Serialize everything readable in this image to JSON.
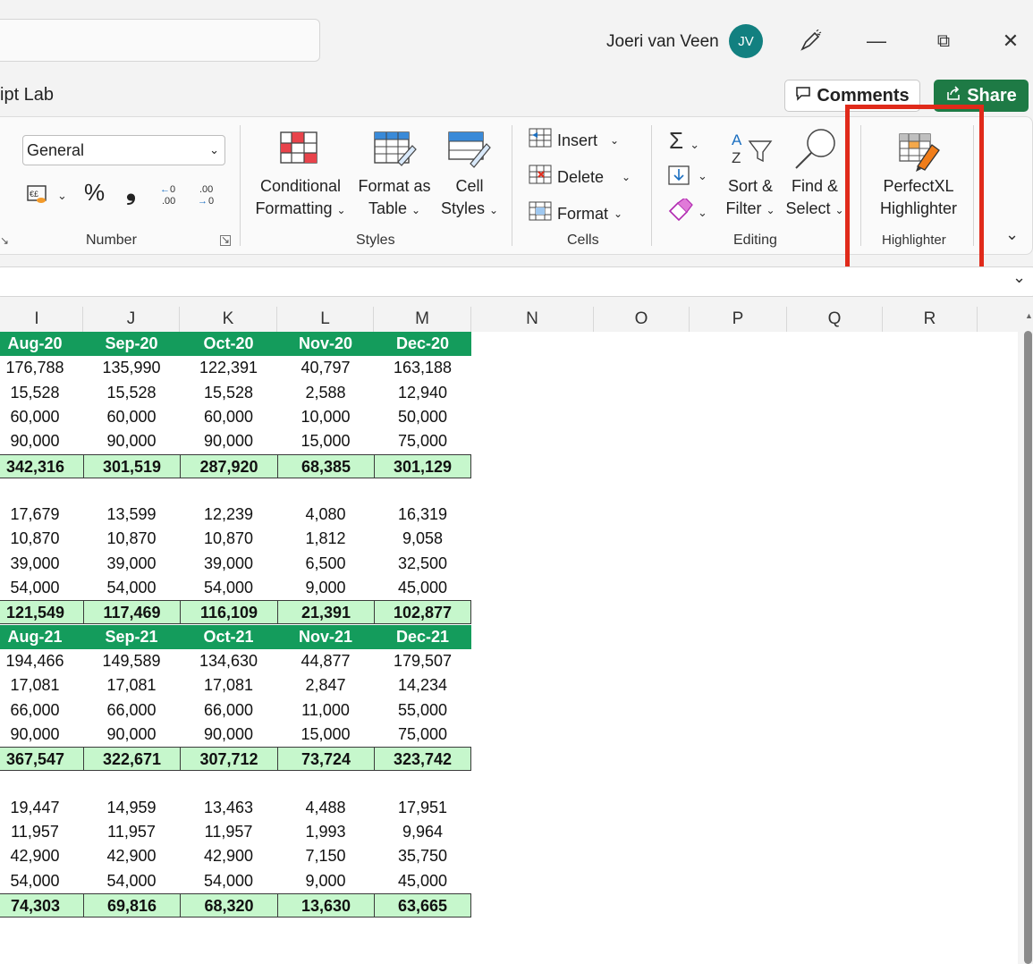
{
  "titlebar": {
    "user_name": "Joeri van Veen",
    "avatar_initials": "JV",
    "minimize": "—",
    "restore": "⧉",
    "close": "✕"
  },
  "tabbar": {
    "tab_partial": "ipt Lab",
    "comments_label": "Comments",
    "share_label": "Share"
  },
  "ribbon": {
    "number": {
      "format_value": "General",
      "percent": "%",
      "comma": "❟",
      "inc_decimal": "←0 .00",
      "dec_decimal": ".00 →0",
      "group_label": "Number"
    },
    "styles": {
      "conditional_line1": "Conditional",
      "conditional_line2": "Formatting",
      "format_table_line1": "Format as",
      "format_table_line2": "Table",
      "cell_styles_line1": "Cell",
      "cell_styles_line2": "Styles",
      "group_label": "Styles"
    },
    "cells": {
      "insert": "Insert",
      "delete": "Delete",
      "format": "Format",
      "group_label": "Cells"
    },
    "editing": {
      "sort_line1": "Sort &",
      "sort_line2": "Filter",
      "find_line1": "Find &",
      "find_line2": "Select",
      "group_label": "Editing"
    },
    "highlighter": {
      "line1": "PerfectXL",
      "line2": "Highlighter",
      "group_label": "Highlighter"
    }
  },
  "grid": {
    "columns": [
      "I",
      "J",
      "K",
      "L",
      "M",
      "N",
      "O",
      "P",
      "Q",
      "R"
    ],
    "blocks": [
      {
        "header": [
          "Aug-20",
          "Sep-20",
          "Oct-20",
          "Nov-20",
          "Dec-20"
        ],
        "rows": [
          [
            "176,788",
            "135,990",
            "122,391",
            "40,797",
            "163,188"
          ],
          [
            "15,528",
            "15,528",
            "15,528",
            "2,588",
            "12,940"
          ],
          [
            "60,000",
            "60,000",
            "60,000",
            "10,000",
            "50,000"
          ],
          [
            "90,000",
            "90,000",
            "90,000",
            "15,000",
            "75,000"
          ]
        ],
        "total": [
          "342,316",
          "301,519",
          "287,920",
          "68,385",
          "301,129"
        ]
      },
      {
        "header": null,
        "rows": [
          [
            "17,679",
            "13,599",
            "12,239",
            "4,080",
            "16,319"
          ],
          [
            "10,870",
            "10,870",
            "10,870",
            "1,812",
            "9,058"
          ],
          [
            "39,000",
            "39,000",
            "39,000",
            "6,500",
            "32,500"
          ],
          [
            "54,000",
            "54,000",
            "54,000",
            "9,000",
            "45,000"
          ]
        ],
        "total": [
          "121,549",
          "117,469",
          "116,109",
          "21,391",
          "102,877"
        ]
      },
      {
        "header": [
          "Aug-21",
          "Sep-21",
          "Oct-21",
          "Nov-21",
          "Dec-21"
        ],
        "rows": [
          [
            "194,466",
            "149,589",
            "134,630",
            "44,877",
            "179,507"
          ],
          [
            "17,081",
            "17,081",
            "17,081",
            "2,847",
            "14,234"
          ],
          [
            "66,000",
            "66,000",
            "66,000",
            "11,000",
            "55,000"
          ],
          [
            "90,000",
            "90,000",
            "90,000",
            "15,000",
            "75,000"
          ]
        ],
        "total": [
          "367,547",
          "322,671",
          "307,712",
          "73,724",
          "323,742"
        ]
      },
      {
        "header": null,
        "rows": [
          [
            "19,447",
            "14,959",
            "13,463",
            "4,488",
            "17,951"
          ],
          [
            "11,957",
            "11,957",
            "11,957",
            "1,993",
            "9,964"
          ],
          [
            "42,900",
            "42,900",
            "42,900",
            "7,150",
            "35,750"
          ],
          [
            "54,000",
            "54,000",
            "54,000",
            "9,000",
            "45,000"
          ]
        ],
        "total": [
          "74,303",
          "69,816",
          "68,320",
          "13,630",
          "63,665"
        ]
      }
    ]
  },
  "colors": {
    "header_fill": "#149c5c",
    "total_fill": "#c6f7cc",
    "highlight_border": "#e02a1a",
    "share_button": "#1e7a45",
    "avatar": "#128080"
  }
}
